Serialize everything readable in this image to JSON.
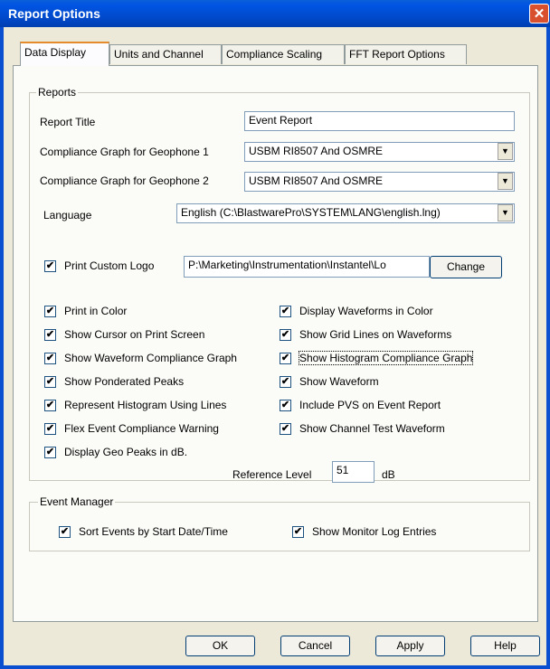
{
  "window": {
    "title": "Report Options",
    "close_glyph": "✕"
  },
  "tabs": [
    "Data Display",
    "Units and Channel",
    "Compliance Scaling",
    "FFT Report Options"
  ],
  "reports": {
    "group_label": "Reports",
    "report_title_label": "Report Title",
    "report_title_value": "Event Report",
    "geo1_label": "Compliance Graph for Geophone 1",
    "geo1_value": "USBM RI8507 And OSMRE",
    "geo2_label": "Compliance Graph for Geophone 2",
    "geo2_value": "USBM RI8507 And OSMRE",
    "language_label": "Language",
    "language_value": "English (C:\\BlastwarePro\\SYSTEM\\LANG\\english.lng)",
    "print_logo_label": "Print Custom Logo",
    "logo_path": "P:\\Marketing\\Instrumentation\\Instantel\\Lo",
    "change_label": "Change",
    "checkboxes_left": [
      {
        "label": "Print in Color",
        "checked": true
      },
      {
        "label": "Show Cursor on Print Screen",
        "checked": true
      },
      {
        "label": "Show Waveform Compliance Graph",
        "checked": true
      },
      {
        "label": "Show Ponderated Peaks",
        "checked": true
      },
      {
        "label": "Represent Histogram Using Lines",
        "checked": true
      },
      {
        "label": "Flex Event Compliance Warning",
        "checked": true
      },
      {
        "label": "Display Geo Peaks in dB.",
        "checked": true
      }
    ],
    "checkboxes_right": [
      {
        "label": "Display Waveforms in Color",
        "checked": true
      },
      {
        "label": "Show Grid Lines on Waveforms",
        "checked": true
      },
      {
        "label": "Show Histogram Compliance Graph",
        "checked": true
      },
      {
        "label": "Show Waveform",
        "checked": true
      },
      {
        "label": "Include PVS on Event Report",
        "checked": true
      },
      {
        "label": "Show Channel Test Waveform",
        "checked": true
      }
    ],
    "reference_level_label": "Reference Level",
    "reference_level_value": "51",
    "reference_level_unit": "dB"
  },
  "event_manager": {
    "group_label": "Event Manager",
    "sort_label": "Sort  Events by Start Date/Time",
    "sort_checked": true,
    "monitor_label": "Show Monitor Log Entries",
    "monitor_checked": true
  },
  "buttons": {
    "ok": "OK",
    "cancel": "Cancel",
    "apply": "Apply",
    "help": "Help"
  },
  "check_glyph": "✔",
  "dropdown_glyph": "▼"
}
